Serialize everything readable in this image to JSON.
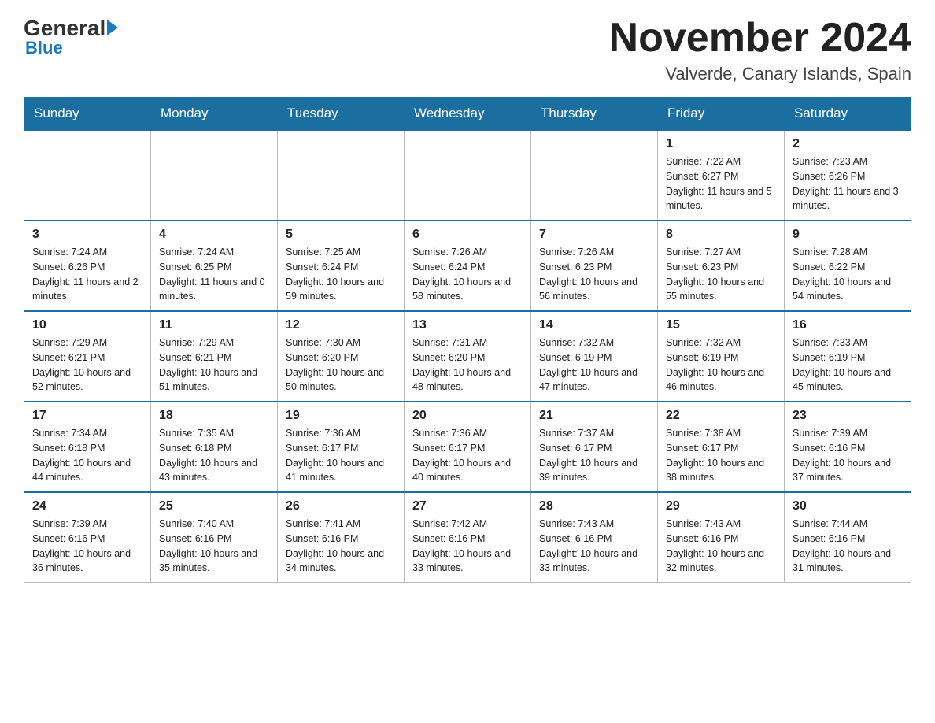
{
  "header": {
    "logo_general": "General",
    "logo_blue": "Blue",
    "month_title": "November 2024",
    "location": "Valverde, Canary Islands, Spain"
  },
  "days_of_week": [
    "Sunday",
    "Monday",
    "Tuesday",
    "Wednesday",
    "Thursday",
    "Friday",
    "Saturday"
  ],
  "weeks": [
    [
      {
        "day": "",
        "sunrise": "",
        "sunset": "",
        "daylight": "",
        "empty": true
      },
      {
        "day": "",
        "sunrise": "",
        "sunset": "",
        "daylight": "",
        "empty": true
      },
      {
        "day": "",
        "sunrise": "",
        "sunset": "",
        "daylight": "",
        "empty": true
      },
      {
        "day": "",
        "sunrise": "",
        "sunset": "",
        "daylight": "",
        "empty": true
      },
      {
        "day": "",
        "sunrise": "",
        "sunset": "",
        "daylight": "",
        "empty": true
      },
      {
        "day": "1",
        "sunrise": "Sunrise: 7:22 AM",
        "sunset": "Sunset: 6:27 PM",
        "daylight": "Daylight: 11 hours and 5 minutes.",
        "empty": false
      },
      {
        "day": "2",
        "sunrise": "Sunrise: 7:23 AM",
        "sunset": "Sunset: 6:26 PM",
        "daylight": "Daylight: 11 hours and 3 minutes.",
        "empty": false
      }
    ],
    [
      {
        "day": "3",
        "sunrise": "Sunrise: 7:24 AM",
        "sunset": "Sunset: 6:26 PM",
        "daylight": "Daylight: 11 hours and 2 minutes.",
        "empty": false
      },
      {
        "day": "4",
        "sunrise": "Sunrise: 7:24 AM",
        "sunset": "Sunset: 6:25 PM",
        "daylight": "Daylight: 11 hours and 0 minutes.",
        "empty": false
      },
      {
        "day": "5",
        "sunrise": "Sunrise: 7:25 AM",
        "sunset": "Sunset: 6:24 PM",
        "daylight": "Daylight: 10 hours and 59 minutes.",
        "empty": false
      },
      {
        "day": "6",
        "sunrise": "Sunrise: 7:26 AM",
        "sunset": "Sunset: 6:24 PM",
        "daylight": "Daylight: 10 hours and 58 minutes.",
        "empty": false
      },
      {
        "day": "7",
        "sunrise": "Sunrise: 7:26 AM",
        "sunset": "Sunset: 6:23 PM",
        "daylight": "Daylight: 10 hours and 56 minutes.",
        "empty": false
      },
      {
        "day": "8",
        "sunrise": "Sunrise: 7:27 AM",
        "sunset": "Sunset: 6:23 PM",
        "daylight": "Daylight: 10 hours and 55 minutes.",
        "empty": false
      },
      {
        "day": "9",
        "sunrise": "Sunrise: 7:28 AM",
        "sunset": "Sunset: 6:22 PM",
        "daylight": "Daylight: 10 hours and 54 minutes.",
        "empty": false
      }
    ],
    [
      {
        "day": "10",
        "sunrise": "Sunrise: 7:29 AM",
        "sunset": "Sunset: 6:21 PM",
        "daylight": "Daylight: 10 hours and 52 minutes.",
        "empty": false
      },
      {
        "day": "11",
        "sunrise": "Sunrise: 7:29 AM",
        "sunset": "Sunset: 6:21 PM",
        "daylight": "Daylight: 10 hours and 51 minutes.",
        "empty": false
      },
      {
        "day": "12",
        "sunrise": "Sunrise: 7:30 AM",
        "sunset": "Sunset: 6:20 PM",
        "daylight": "Daylight: 10 hours and 50 minutes.",
        "empty": false
      },
      {
        "day": "13",
        "sunrise": "Sunrise: 7:31 AM",
        "sunset": "Sunset: 6:20 PM",
        "daylight": "Daylight: 10 hours and 48 minutes.",
        "empty": false
      },
      {
        "day": "14",
        "sunrise": "Sunrise: 7:32 AM",
        "sunset": "Sunset: 6:19 PM",
        "daylight": "Daylight: 10 hours and 47 minutes.",
        "empty": false
      },
      {
        "day": "15",
        "sunrise": "Sunrise: 7:32 AM",
        "sunset": "Sunset: 6:19 PM",
        "daylight": "Daylight: 10 hours and 46 minutes.",
        "empty": false
      },
      {
        "day": "16",
        "sunrise": "Sunrise: 7:33 AM",
        "sunset": "Sunset: 6:19 PM",
        "daylight": "Daylight: 10 hours and 45 minutes.",
        "empty": false
      }
    ],
    [
      {
        "day": "17",
        "sunrise": "Sunrise: 7:34 AM",
        "sunset": "Sunset: 6:18 PM",
        "daylight": "Daylight: 10 hours and 44 minutes.",
        "empty": false
      },
      {
        "day": "18",
        "sunrise": "Sunrise: 7:35 AM",
        "sunset": "Sunset: 6:18 PM",
        "daylight": "Daylight: 10 hours and 43 minutes.",
        "empty": false
      },
      {
        "day": "19",
        "sunrise": "Sunrise: 7:36 AM",
        "sunset": "Sunset: 6:17 PM",
        "daylight": "Daylight: 10 hours and 41 minutes.",
        "empty": false
      },
      {
        "day": "20",
        "sunrise": "Sunrise: 7:36 AM",
        "sunset": "Sunset: 6:17 PM",
        "daylight": "Daylight: 10 hours and 40 minutes.",
        "empty": false
      },
      {
        "day": "21",
        "sunrise": "Sunrise: 7:37 AM",
        "sunset": "Sunset: 6:17 PM",
        "daylight": "Daylight: 10 hours and 39 minutes.",
        "empty": false
      },
      {
        "day": "22",
        "sunrise": "Sunrise: 7:38 AM",
        "sunset": "Sunset: 6:17 PM",
        "daylight": "Daylight: 10 hours and 38 minutes.",
        "empty": false
      },
      {
        "day": "23",
        "sunrise": "Sunrise: 7:39 AM",
        "sunset": "Sunset: 6:16 PM",
        "daylight": "Daylight: 10 hours and 37 minutes.",
        "empty": false
      }
    ],
    [
      {
        "day": "24",
        "sunrise": "Sunrise: 7:39 AM",
        "sunset": "Sunset: 6:16 PM",
        "daylight": "Daylight: 10 hours and 36 minutes.",
        "empty": false
      },
      {
        "day": "25",
        "sunrise": "Sunrise: 7:40 AM",
        "sunset": "Sunset: 6:16 PM",
        "daylight": "Daylight: 10 hours and 35 minutes.",
        "empty": false
      },
      {
        "day": "26",
        "sunrise": "Sunrise: 7:41 AM",
        "sunset": "Sunset: 6:16 PM",
        "daylight": "Daylight: 10 hours and 34 minutes.",
        "empty": false
      },
      {
        "day": "27",
        "sunrise": "Sunrise: 7:42 AM",
        "sunset": "Sunset: 6:16 PM",
        "daylight": "Daylight: 10 hours and 33 minutes.",
        "empty": false
      },
      {
        "day": "28",
        "sunrise": "Sunrise: 7:43 AM",
        "sunset": "Sunset: 6:16 PM",
        "daylight": "Daylight: 10 hours and 33 minutes.",
        "empty": false
      },
      {
        "day": "29",
        "sunrise": "Sunrise: 7:43 AM",
        "sunset": "Sunset: 6:16 PM",
        "daylight": "Daylight: 10 hours and 32 minutes.",
        "empty": false
      },
      {
        "day": "30",
        "sunrise": "Sunrise: 7:44 AM",
        "sunset": "Sunset: 6:16 PM",
        "daylight": "Daylight: 10 hours and 31 minutes.",
        "empty": false
      }
    ]
  ]
}
